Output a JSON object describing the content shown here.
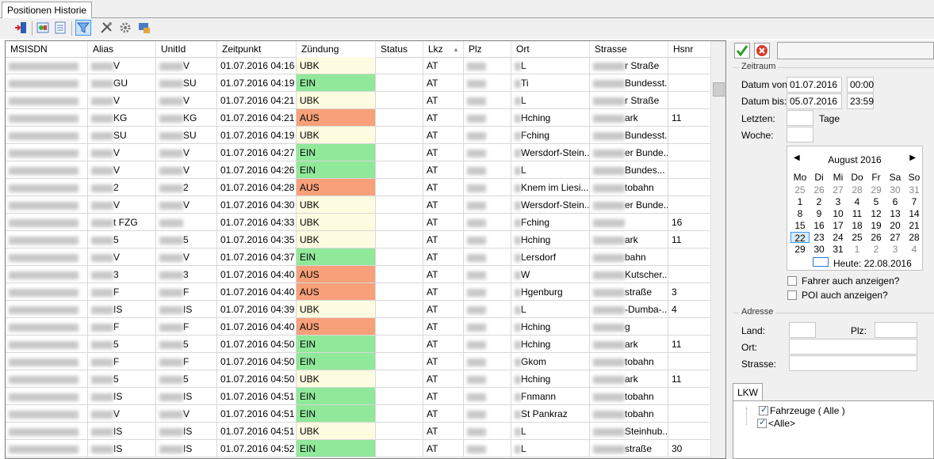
{
  "tab": {
    "label": "Positionen Historie"
  },
  "toolbar": {
    "icons": [
      "exit-icon",
      "refresh-map-icon",
      "list-icon",
      "filter-icon",
      "tools-icon",
      "settings-icon",
      "export-icon"
    ]
  },
  "grid": {
    "columns": [
      "MSISDN",
      "Alias",
      "UnitId",
      "Zeitpunkt",
      "Zündung",
      "Status",
      "Lkz",
      "Plz",
      "Ort",
      "Strasse",
      "Hsnr"
    ],
    "rows": [
      {
        "alias": "V",
        "unit": "V",
        "time": "01.07.2016 04:16",
        "ign": "UBK",
        "lkz": "AT",
        "ort": "L",
        "str": "r Straße",
        "hsnr": ""
      },
      {
        "alias": "GU",
        "unit": "SU",
        "time": "01.07.2016 04:19",
        "ign": "EIN",
        "lkz": "AT",
        "ort": "Ti",
        "str": "Bundesst...",
        "hsnr": ""
      },
      {
        "alias": "V",
        "unit": "V",
        "time": "01.07.2016 04:21",
        "ign": "UBK",
        "lkz": "AT",
        "ort": "L",
        "str": "r Straße",
        "hsnr": ""
      },
      {
        "alias": "KG",
        "unit": "KG",
        "time": "01.07.2016 04:21",
        "ign": "AUS",
        "lkz": "AT",
        "ort": "Hching",
        "str": "ark",
        "hsnr": "11"
      },
      {
        "alias": "SU",
        "unit": "SU",
        "time": "01.07.2016 04:19",
        "ign": "UBK",
        "lkz": "AT",
        "ort": "Fching",
        "str": "Bundesst...",
        "hsnr": ""
      },
      {
        "alias": "V",
        "unit": "V",
        "time": "01.07.2016 04:27",
        "ign": "EIN",
        "lkz": "AT",
        "ort": "Wersdorf-Stein...",
        "str": "er Bunde...",
        "hsnr": ""
      },
      {
        "alias": "V",
        "unit": "V",
        "time": "01.07.2016 04:26",
        "ign": "EIN",
        "lkz": "AT",
        "ort": "L",
        "str": "Bundes...",
        "hsnr": ""
      },
      {
        "alias": "2",
        "unit": "2",
        "time": "01.07.2016 04:28",
        "ign": "AUS",
        "lkz": "AT",
        "ort": "Knem im Liesi...",
        "str": "tobahn",
        "hsnr": ""
      },
      {
        "alias": "V",
        "unit": "V",
        "time": "01.07.2016 04:30",
        "ign": "UBK",
        "lkz": "AT",
        "ort": "Wersdorf-Stein...",
        "str": "er Bunde...",
        "hsnr": ""
      },
      {
        "alias": "t FZG",
        "unit": "",
        "time": "01.07.2016 04:33",
        "ign": "UBK",
        "lkz": "AT",
        "ort": "Fching",
        "str": "",
        "hsnr": "16"
      },
      {
        "alias": "5",
        "unit": "5",
        "time": "01.07.2016 04:35",
        "ign": "UBK",
        "lkz": "AT",
        "ort": "Hching",
        "str": "ark",
        "hsnr": "11"
      },
      {
        "alias": "V",
        "unit": "V",
        "time": "01.07.2016 04:37",
        "ign": "EIN",
        "lkz": "AT",
        "ort": "Lersdorf",
        "str": "bahn",
        "hsnr": ""
      },
      {
        "alias": "3",
        "unit": "3",
        "time": "01.07.2016 04:40",
        "ign": "AUS",
        "lkz": "AT",
        "ort": "W",
        "str": "Kutscher...",
        "hsnr": ""
      },
      {
        "alias": "F",
        "unit": "F",
        "time": "01.07.2016 04:40",
        "ign": "AUS",
        "lkz": "AT",
        "ort": "Hgenburg",
        "str": "straße",
        "hsnr": "3"
      },
      {
        "alias": "IS",
        "unit": "IS",
        "time": "01.07.2016 04:39",
        "ign": "UBK",
        "lkz": "AT",
        "ort": "L",
        "str": "-Dumba-...",
        "hsnr": "4"
      },
      {
        "alias": "F",
        "unit": "F",
        "time": "01.07.2016 04:40",
        "ign": "AUS",
        "lkz": "AT",
        "ort": "Hching",
        "str": "g",
        "hsnr": ""
      },
      {
        "alias": "5",
        "unit": "5",
        "time": "01.07.2016 04:50",
        "ign": "EIN",
        "lkz": "AT",
        "ort": "Hching",
        "str": "ark",
        "hsnr": "11"
      },
      {
        "alias": "F",
        "unit": "F",
        "time": "01.07.2016 04:50",
        "ign": "EIN",
        "lkz": "AT",
        "ort": "Gkom",
        "str": "tobahn",
        "hsnr": ""
      },
      {
        "alias": "5",
        "unit": "5",
        "time": "01.07.2016 04:50",
        "ign": "UBK",
        "lkz": "AT",
        "ort": "Hching",
        "str": "ark",
        "hsnr": "11"
      },
      {
        "alias": "IS",
        "unit": "IS",
        "time": "01.07.2016 04:51",
        "ign": "EIN",
        "lkz": "AT",
        "ort": "Fnmann",
        "str": "tobahn",
        "hsnr": ""
      },
      {
        "alias": "V",
        "unit": "V",
        "time": "01.07.2016 04:51",
        "ign": "EIN",
        "lkz": "AT",
        "ort": "St Pankraz",
        "str": "tobahn",
        "hsnr": ""
      },
      {
        "alias": "IS",
        "unit": "IS",
        "time": "01.07.2016 04:51",
        "ign": "UBK",
        "lkz": "AT",
        "ort": "L",
        "str": "Steinhub...",
        "hsnr": ""
      },
      {
        "alias": "IS",
        "unit": "IS",
        "time": "01.07.2016 04:52",
        "ign": "EIN",
        "lkz": "AT",
        "ort": "L",
        "str": "straße",
        "hsnr": "30"
      }
    ]
  },
  "colors": {
    "UBK": "#fdfbe0",
    "EIN": "#90e89a",
    "AUS": "#f7a07a"
  },
  "panel": {
    "zeitraum_label": "Zeitraum",
    "von_label": "Datum von:",
    "von_date": "01.07.2016",
    "von_time": "00:00",
    "bis_label": "Datum bis:",
    "bis_date": "05.07.2016",
    "bis_time": "23:59",
    "letzten_label": "Letzten:",
    "tage_label": "Tage",
    "woche_label": "Woche:",
    "calendar": {
      "month": "August 2016",
      "dows": [
        "Mo",
        "Di",
        "Mi",
        "Do",
        "Fr",
        "Sa",
        "So"
      ],
      "weeks": [
        [
          [
            "25",
            1
          ],
          [
            "26",
            1
          ],
          [
            "27",
            1
          ],
          [
            "28",
            1
          ],
          [
            "29",
            1
          ],
          [
            "30",
            1
          ],
          [
            "31",
            1
          ]
        ],
        [
          [
            "1",
            0
          ],
          [
            "2",
            0
          ],
          [
            "3",
            0
          ],
          [
            "4",
            0
          ],
          [
            "5",
            0
          ],
          [
            "6",
            0
          ],
          [
            "7",
            0
          ]
        ],
        [
          [
            "8",
            0
          ],
          [
            "9",
            0
          ],
          [
            "10",
            0
          ],
          [
            "11",
            0
          ],
          [
            "12",
            0
          ],
          [
            "13",
            0
          ],
          [
            "14",
            0
          ]
        ],
        [
          [
            "15",
            0
          ],
          [
            "16",
            0
          ],
          [
            "17",
            0
          ],
          [
            "18",
            0
          ],
          [
            "19",
            0
          ],
          [
            "20",
            0
          ],
          [
            "21",
            0
          ]
        ],
        [
          [
            "22",
            2
          ],
          [
            "23",
            0
          ],
          [
            "24",
            0
          ],
          [
            "25",
            0
          ],
          [
            "26",
            0
          ],
          [
            "27",
            0
          ],
          [
            "28",
            0
          ]
        ],
        [
          [
            "29",
            0
          ],
          [
            "30",
            0
          ],
          [
            "31",
            0
          ],
          [
            "1",
            1
          ],
          [
            "2",
            1
          ],
          [
            "3",
            1
          ],
          [
            "4",
            1
          ]
        ]
      ],
      "today": "Heute: 22.08.2016"
    },
    "fahrer_label": "Fahrer auch anzeigen?",
    "poi_label": "POI auch anzeigen?",
    "adresse_label": "Adresse",
    "land_label": "Land:",
    "plz_label": "Plz:",
    "ort_label": "Ort:",
    "strasse_label": "Strasse:",
    "lkw_tab": "LKW",
    "tree_root": "Fahrzeuge  ( Alle )",
    "tree_child": "<Alle>"
  }
}
